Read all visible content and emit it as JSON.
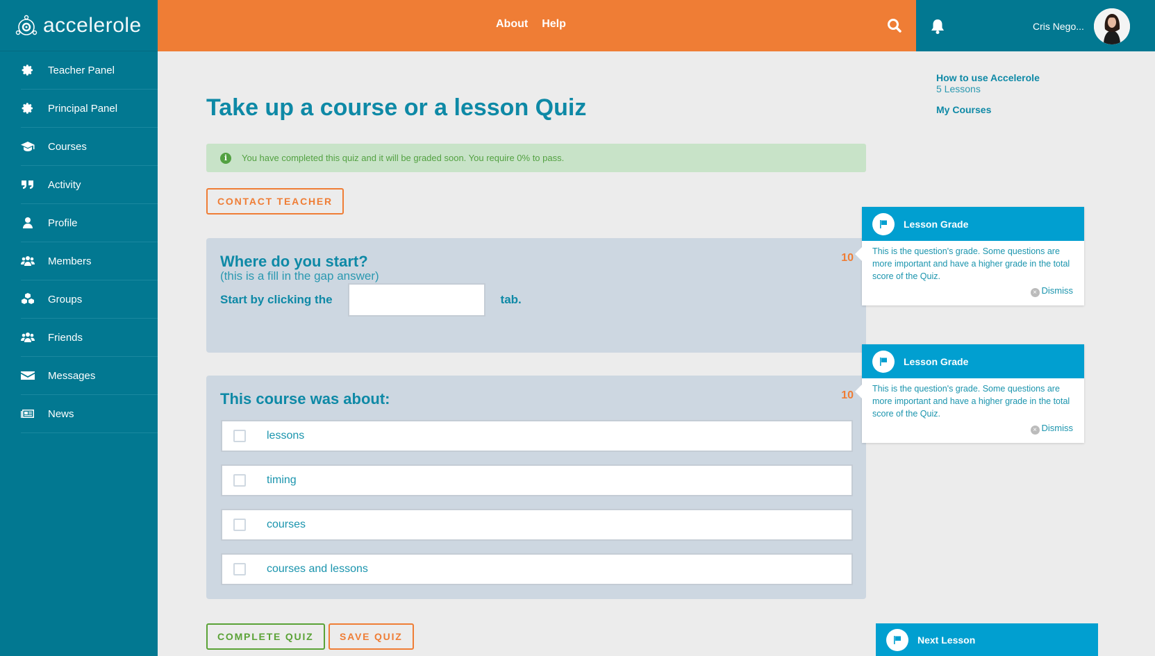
{
  "app": {
    "name": "accelerole"
  },
  "sidebar": {
    "items": [
      {
        "label": "Teacher Panel",
        "icon": "gear-icon"
      },
      {
        "label": "Principal Panel",
        "icon": "gear-icon"
      },
      {
        "label": "Courses",
        "icon": "graduation-cap-icon"
      },
      {
        "label": "Activity",
        "icon": "quote-icon"
      },
      {
        "label": "Profile",
        "icon": "user-icon"
      },
      {
        "label": "Members",
        "icon": "users-icon"
      },
      {
        "label": "Groups",
        "icon": "cubes-icon"
      },
      {
        "label": "Friends",
        "icon": "users-icon"
      },
      {
        "label": "Messages",
        "icon": "envelope-icon"
      },
      {
        "label": "News",
        "icon": "newspaper-icon"
      }
    ]
  },
  "topbar": {
    "links": [
      "About",
      "Help"
    ],
    "search_icon": "search-icon",
    "bell_icon": "bell-icon",
    "username": "Cris Nego..."
  },
  "main": {
    "title": "Take up a course or a lesson Quiz",
    "alert": "You have completed this quiz and it will be graded soon. You require 0% to pass.",
    "contact_teacher": "CONTACT TEACHER",
    "questions": [
      {
        "title": "Where do you start?",
        "subtitle": "(this is a fill in the gap answer)",
        "grade": "10",
        "prefix": "Start by clicking the",
        "input_value": "",
        "suffix": "tab."
      },
      {
        "title": "This course was about:",
        "grade": "10",
        "options": [
          "lessons",
          "timing",
          "courses",
          "courses and lessons"
        ]
      }
    ],
    "complete_quiz": "COMPLETE QUIZ",
    "save_quiz": "SAVE QUIZ"
  },
  "right": {
    "course_title": "How to use Accelerole",
    "course_lessons": "5 Lessons",
    "my_courses": "My Courses",
    "tips": [
      {
        "title": "Lesson Grade",
        "body": "This is the question's grade. Some questions are more important and have a higher grade in the total score of the Quiz.",
        "dismiss": "Dismiss"
      },
      {
        "title": "Lesson Grade",
        "body": "This is the question's grade. Some questions are more important and have a higher grade in the total score of the Quiz.",
        "dismiss": "Dismiss"
      }
    ],
    "next_lesson": "Next Lesson"
  },
  "colors": {
    "primary": "#027891",
    "accent": "#ef7d35",
    "tip_blue": "#019fd0",
    "success": "#5aa236"
  }
}
